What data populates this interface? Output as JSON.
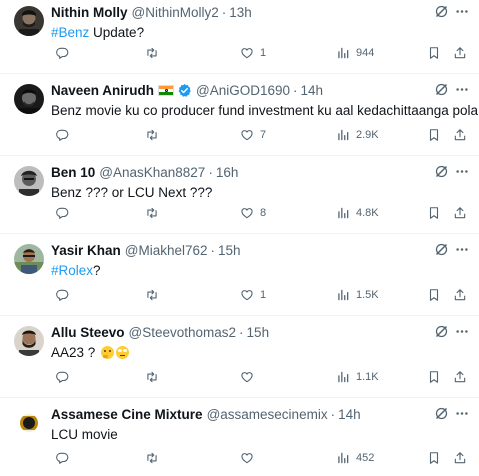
{
  "tweets": [
    {
      "name": "Nithin Molly",
      "handle": "@NithinMolly2",
      "dot": "·",
      "time": "13h",
      "text_parts": [
        {
          "t": "#Benz",
          "tag": true
        },
        {
          "t": " Update?",
          "tag": false
        }
      ],
      "replies": "",
      "retweets": "",
      "likes": "1",
      "views": "944",
      "avatar": "dark-beard"
    },
    {
      "name": "Naveen Anirudh",
      "has_flag": true,
      "verified": true,
      "handle": "@AniGOD1690",
      "dot": "·",
      "time": "14h",
      "text_parts": [
        {
          "t": "Benz movie ku co producer fund investment ku aal kedachittaanga pola",
          "tag": false
        }
      ],
      "replies": "",
      "retweets": "",
      "likes": "7",
      "views": "2.9K",
      "avatar": "dark-bw"
    },
    {
      "name": "Ben 10",
      "handle": "@AnasKhan8827",
      "dot": "·",
      "time": "16h",
      "text_parts": [
        {
          "t": "Benz ??? or LCU Next ???",
          "tag": false
        }
      ],
      "replies": "",
      "retweets": "",
      "likes": "8",
      "views": "4.8K",
      "avatar": "bw-portrait"
    },
    {
      "name": "Yasir Khan",
      "handle": "@Miakhel762",
      "dot": "·",
      "time": "15h",
      "text_parts": [
        {
          "t": "#Rolex",
          "tag": true
        },
        {
          "t": "?",
          "tag": false
        }
      ],
      "replies": "",
      "retweets": "",
      "likes": "1",
      "views": "1.5K",
      "avatar": "outdoor"
    },
    {
      "name": "Allu Steevo",
      "handle": "@Steevothomas2",
      "dot": "·",
      "time": "15h",
      "text_parts": [
        {
          "t": "AA23 ? ",
          "tag": false
        }
      ],
      "emojis": [
        "thinking-emoji",
        "eye-roll-emoji"
      ],
      "replies": "",
      "retweets": "",
      "likes": "",
      "views": "1.1K",
      "avatar": "beard-light"
    },
    {
      "name": "Assamese Cine Mixture",
      "handle": "@assamesecinemix",
      "dot": "·",
      "time": "14h",
      "text_parts": [
        {
          "t": "LCU movie",
          "tag": false
        }
      ],
      "replies": "",
      "retweets": "",
      "likes": "",
      "views": "452",
      "avatar": "logo",
      "avatar_text": [
        "ASSAMESE",
        "CINE",
        "MIXTURE"
      ]
    }
  ],
  "colors": {
    "accent": "#1d9bf0",
    "secondary_text": "#536471",
    "divider": "#eff3f4"
  },
  "icons": [
    "grok-icon",
    "more-icon",
    "reply-icon",
    "retweet-icon",
    "like-icon",
    "views-icon",
    "bookmark-icon",
    "share-icon",
    "verified-icon",
    "india-flag-icon"
  ]
}
